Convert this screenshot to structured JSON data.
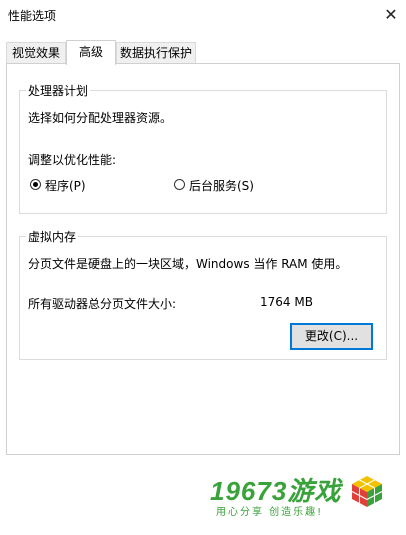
{
  "window": {
    "title": "性能选项",
    "close_glyph": "✕"
  },
  "tabs": [
    {
      "label": "视觉效果"
    },
    {
      "label": "高级"
    },
    {
      "label": "数据执行保护"
    }
  ],
  "processor": {
    "legend": "处理器计划",
    "description": "选择如何分配处理器资源。",
    "adjust_label": "调整以优化性能:",
    "options": [
      {
        "label": "程序(P)",
        "selected": true
      },
      {
        "label": "后台服务(S)",
        "selected": false
      }
    ]
  },
  "virtual_memory": {
    "legend": "虚拟内存",
    "description": "分页文件是硬盘上的一块区域，Windows 当作 RAM 使用。",
    "total_label": "所有驱动器总分页文件大小:",
    "total_value": "1764 MB",
    "change_button": "更改(C)..."
  },
  "watermark": {
    "brand": "19673游戏",
    "slogan": "用心分享  创造乐趣!",
    "color": "#3aa23a"
  }
}
